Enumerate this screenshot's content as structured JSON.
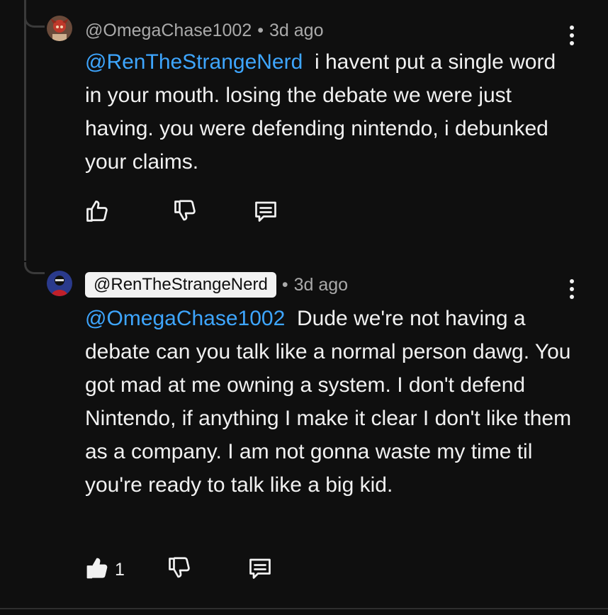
{
  "comments": [
    {
      "handle": "@OmegaChase1002",
      "separator": "•",
      "time": "3d ago",
      "mention": "@RenTheStrangeNerd",
      "text": "i havent put a single word in your mouth. losing the debate we were just having. you were defending nintendo, i debunked your claims.",
      "likes": ""
    },
    {
      "handle": "@RenTheStrangeNerd",
      "separator": "•",
      "time": "3d ago",
      "mention": "@OmegaChase1002",
      "text": "Dude we're not having a debate can you talk like a normal person dawg. You got mad at me owning a system. I don't defend Nintendo, if anything I make it clear I don't like them as a company. I am not gonna waste my time til you're ready to talk like a big kid.",
      "likes": "1"
    }
  ],
  "icons": {
    "like": "thumbs-up-icon",
    "like_filled": "thumbs-up-filled-icon",
    "dislike": "thumbs-down-icon",
    "reply": "reply-comment-icon",
    "menu": "more-vertical-icon"
  },
  "colors": {
    "background": "#0f0f0f",
    "text": "#f1f1f1",
    "meta": "#aaaaaa",
    "mention": "#3ea6ff",
    "author_chip_bg": "#f2f2f2"
  }
}
